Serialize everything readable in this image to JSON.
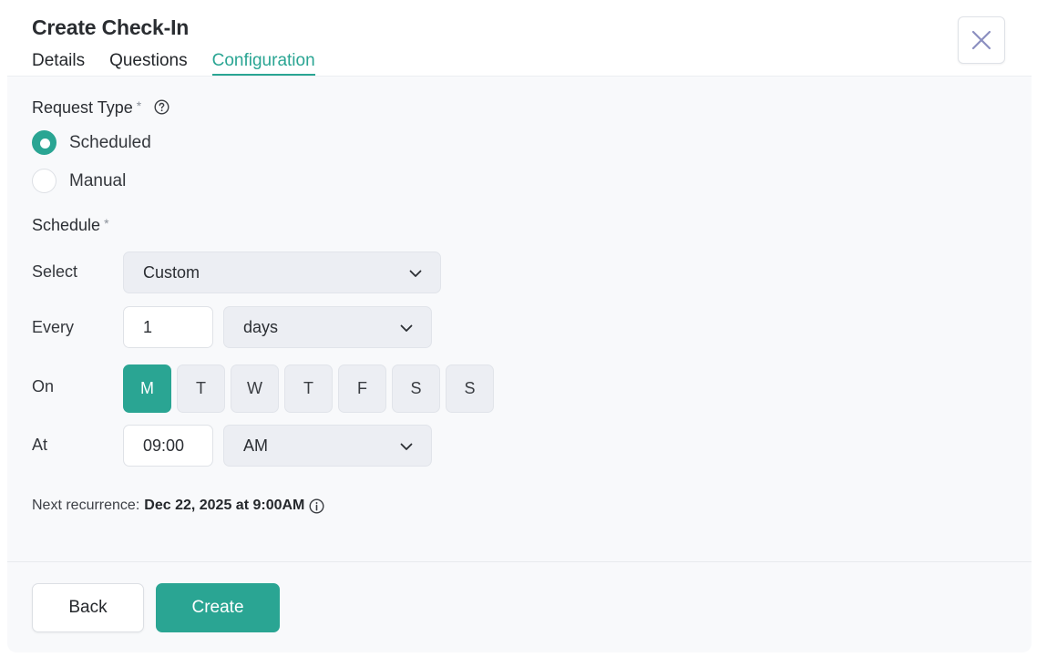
{
  "header": {
    "title": "Create Check-In",
    "tabs": [
      {
        "label": "Details",
        "active": false
      },
      {
        "label": "Questions",
        "active": false
      },
      {
        "label": "Configuration",
        "active": true
      }
    ],
    "close_icon": "close-icon"
  },
  "request_type": {
    "label": "Request Type",
    "required_mark": "*",
    "help_icon": "question-circle-icon",
    "options": [
      {
        "label": "Scheduled",
        "checked": true
      },
      {
        "label": "Manual",
        "checked": false
      }
    ]
  },
  "schedule": {
    "label": "Schedule",
    "required_mark": "*",
    "select": {
      "label": "Select",
      "value": "Custom"
    },
    "every": {
      "label": "Every",
      "count": "1",
      "unit": "days"
    },
    "on": {
      "label": "On",
      "days": [
        {
          "label": "M",
          "active": true
        },
        {
          "label": "T",
          "active": false
        },
        {
          "label": "W",
          "active": false
        },
        {
          "label": "T",
          "active": false
        },
        {
          "label": "F",
          "active": false
        },
        {
          "label": "S",
          "active": false
        },
        {
          "label": "S",
          "active": false
        }
      ]
    },
    "at": {
      "label": "At",
      "time": "09:00",
      "period": "AM"
    }
  },
  "next_recurrence": {
    "label": "Next recurrence:",
    "value": "Dec 22, 2025 at 9:00AM",
    "info_icon": "info-circle-icon"
  },
  "footer": {
    "back_label": "Back",
    "create_label": "Create"
  },
  "colors": {
    "accent": "#2aa593",
    "body_bg": "#f8f9fb",
    "select_bg": "#eceef3"
  }
}
